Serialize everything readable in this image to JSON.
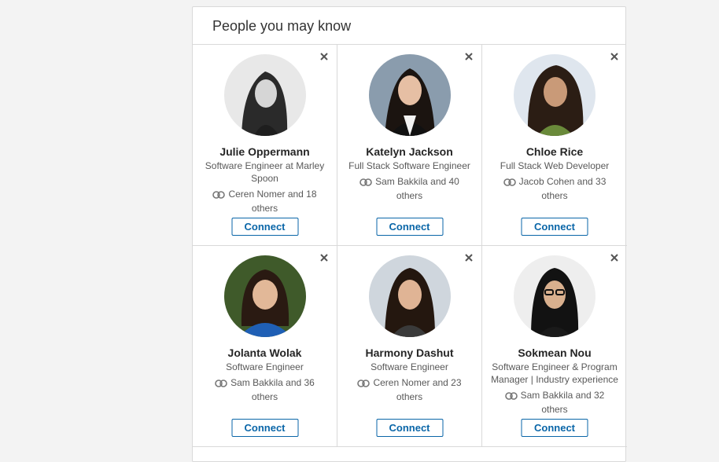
{
  "panel": {
    "title": "People you may know"
  },
  "people": [
    {
      "name": "Julie Oppermann",
      "headline": "Software Engineer at Marley Spoon",
      "shared": "Ceren Nomer and 18 others",
      "connect_label": "Connect",
      "avatar_icon": "person-photo"
    },
    {
      "name": "Katelyn Jackson",
      "headline": "Full Stack Software Engineer",
      "shared": "Sam Bakkila and 40 others",
      "connect_label": "Connect",
      "avatar_icon": "person-photo"
    },
    {
      "name": "Chloe Rice",
      "headline": "Full Stack Web Developer",
      "shared": "Jacob Cohen and 33 others",
      "connect_label": "Connect",
      "avatar_icon": "person-photo"
    },
    {
      "name": "Jolanta Wolak",
      "headline": "Software Engineer",
      "shared": "Sam Bakkila and 36 others",
      "connect_label": "Connect",
      "avatar_icon": "person-photo"
    },
    {
      "name": "Harmony Dashut",
      "headline": "Software Engineer",
      "shared": "Ceren Nomer and 23 others",
      "connect_label": "Connect",
      "avatar_icon": "person-photo"
    },
    {
      "name": "Sokmean Nou",
      "headline": "Software Engineer & Program Manager | Industry experience",
      "shared": "Sam Bakkila and 32 others",
      "connect_label": "Connect",
      "avatar_icon": "person-photo"
    }
  ],
  "colors": {
    "accent": "#0a66a8",
    "border": "#d9d9d9",
    "background": "#f3f3f3"
  }
}
